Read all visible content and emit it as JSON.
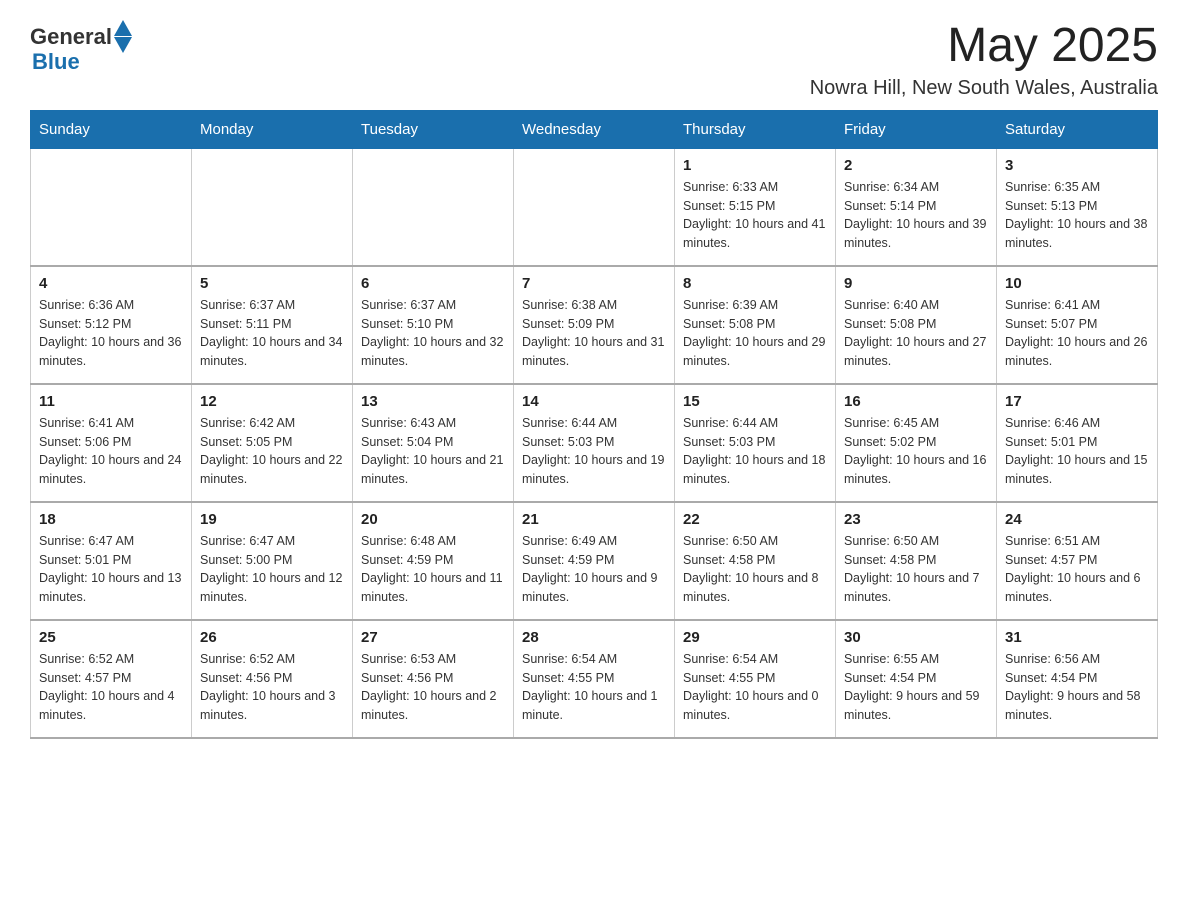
{
  "header": {
    "logo_general": "General",
    "logo_blue": "Blue",
    "month_year": "May 2025",
    "location": "Nowra Hill, New South Wales, Australia"
  },
  "days_of_week": [
    "Sunday",
    "Monday",
    "Tuesday",
    "Wednesday",
    "Thursday",
    "Friday",
    "Saturday"
  ],
  "weeks": [
    [
      {
        "day": "",
        "info": ""
      },
      {
        "day": "",
        "info": ""
      },
      {
        "day": "",
        "info": ""
      },
      {
        "day": "",
        "info": ""
      },
      {
        "day": "1",
        "info": "Sunrise: 6:33 AM\nSunset: 5:15 PM\nDaylight: 10 hours and 41 minutes."
      },
      {
        "day": "2",
        "info": "Sunrise: 6:34 AM\nSunset: 5:14 PM\nDaylight: 10 hours and 39 minutes."
      },
      {
        "day": "3",
        "info": "Sunrise: 6:35 AM\nSunset: 5:13 PM\nDaylight: 10 hours and 38 minutes."
      }
    ],
    [
      {
        "day": "4",
        "info": "Sunrise: 6:36 AM\nSunset: 5:12 PM\nDaylight: 10 hours and 36 minutes."
      },
      {
        "day": "5",
        "info": "Sunrise: 6:37 AM\nSunset: 5:11 PM\nDaylight: 10 hours and 34 minutes."
      },
      {
        "day": "6",
        "info": "Sunrise: 6:37 AM\nSunset: 5:10 PM\nDaylight: 10 hours and 32 minutes."
      },
      {
        "day": "7",
        "info": "Sunrise: 6:38 AM\nSunset: 5:09 PM\nDaylight: 10 hours and 31 minutes."
      },
      {
        "day": "8",
        "info": "Sunrise: 6:39 AM\nSunset: 5:08 PM\nDaylight: 10 hours and 29 minutes."
      },
      {
        "day": "9",
        "info": "Sunrise: 6:40 AM\nSunset: 5:08 PM\nDaylight: 10 hours and 27 minutes."
      },
      {
        "day": "10",
        "info": "Sunrise: 6:41 AM\nSunset: 5:07 PM\nDaylight: 10 hours and 26 minutes."
      }
    ],
    [
      {
        "day": "11",
        "info": "Sunrise: 6:41 AM\nSunset: 5:06 PM\nDaylight: 10 hours and 24 minutes."
      },
      {
        "day": "12",
        "info": "Sunrise: 6:42 AM\nSunset: 5:05 PM\nDaylight: 10 hours and 22 minutes."
      },
      {
        "day": "13",
        "info": "Sunrise: 6:43 AM\nSunset: 5:04 PM\nDaylight: 10 hours and 21 minutes."
      },
      {
        "day": "14",
        "info": "Sunrise: 6:44 AM\nSunset: 5:03 PM\nDaylight: 10 hours and 19 minutes."
      },
      {
        "day": "15",
        "info": "Sunrise: 6:44 AM\nSunset: 5:03 PM\nDaylight: 10 hours and 18 minutes."
      },
      {
        "day": "16",
        "info": "Sunrise: 6:45 AM\nSunset: 5:02 PM\nDaylight: 10 hours and 16 minutes."
      },
      {
        "day": "17",
        "info": "Sunrise: 6:46 AM\nSunset: 5:01 PM\nDaylight: 10 hours and 15 minutes."
      }
    ],
    [
      {
        "day": "18",
        "info": "Sunrise: 6:47 AM\nSunset: 5:01 PM\nDaylight: 10 hours and 13 minutes."
      },
      {
        "day": "19",
        "info": "Sunrise: 6:47 AM\nSunset: 5:00 PM\nDaylight: 10 hours and 12 minutes."
      },
      {
        "day": "20",
        "info": "Sunrise: 6:48 AM\nSunset: 4:59 PM\nDaylight: 10 hours and 11 minutes."
      },
      {
        "day": "21",
        "info": "Sunrise: 6:49 AM\nSunset: 4:59 PM\nDaylight: 10 hours and 9 minutes."
      },
      {
        "day": "22",
        "info": "Sunrise: 6:50 AM\nSunset: 4:58 PM\nDaylight: 10 hours and 8 minutes."
      },
      {
        "day": "23",
        "info": "Sunrise: 6:50 AM\nSunset: 4:58 PM\nDaylight: 10 hours and 7 minutes."
      },
      {
        "day": "24",
        "info": "Sunrise: 6:51 AM\nSunset: 4:57 PM\nDaylight: 10 hours and 6 minutes."
      }
    ],
    [
      {
        "day": "25",
        "info": "Sunrise: 6:52 AM\nSunset: 4:57 PM\nDaylight: 10 hours and 4 minutes."
      },
      {
        "day": "26",
        "info": "Sunrise: 6:52 AM\nSunset: 4:56 PM\nDaylight: 10 hours and 3 minutes."
      },
      {
        "day": "27",
        "info": "Sunrise: 6:53 AM\nSunset: 4:56 PM\nDaylight: 10 hours and 2 minutes."
      },
      {
        "day": "28",
        "info": "Sunrise: 6:54 AM\nSunset: 4:55 PM\nDaylight: 10 hours and 1 minute."
      },
      {
        "day": "29",
        "info": "Sunrise: 6:54 AM\nSunset: 4:55 PM\nDaylight: 10 hours and 0 minutes."
      },
      {
        "day": "30",
        "info": "Sunrise: 6:55 AM\nSunset: 4:54 PM\nDaylight: 9 hours and 59 minutes."
      },
      {
        "day": "31",
        "info": "Sunrise: 6:56 AM\nSunset: 4:54 PM\nDaylight: 9 hours and 58 minutes."
      }
    ]
  ]
}
